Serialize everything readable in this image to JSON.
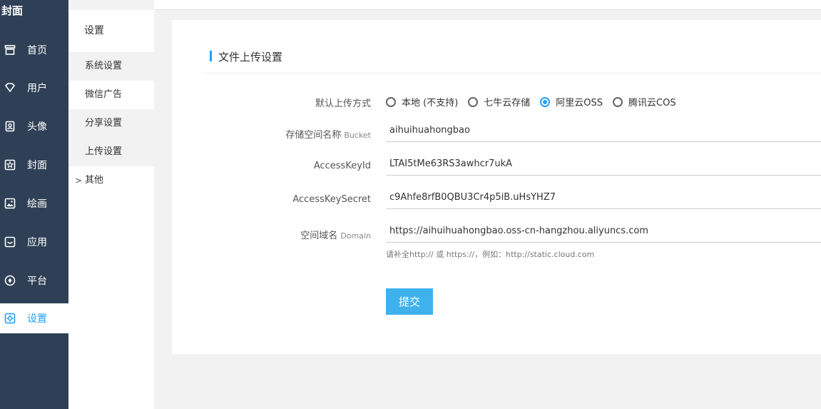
{
  "sidebar": {
    "brand": "封面",
    "items": [
      {
        "label": "首页",
        "icon": "store-icon"
      },
      {
        "label": "用户",
        "icon": "diamond-icon"
      },
      {
        "label": "头像",
        "icon": "user-card-icon"
      },
      {
        "label": "封面",
        "icon": "star-icon"
      },
      {
        "label": "绘画",
        "icon": "image-icon"
      },
      {
        "label": "应用",
        "icon": "app-icon"
      },
      {
        "label": "平台",
        "icon": "compass-icon"
      },
      {
        "label": "设置",
        "icon": "gear-icon"
      }
    ]
  },
  "submenu": {
    "title": "设置",
    "items": [
      "系统设置",
      "微信广告",
      "分享设置",
      "上传设置",
      "其他"
    ]
  },
  "form": {
    "title": "文件上传设置",
    "upload_label": "默认上传方式",
    "upload_options": [
      "本地 (不支持)",
      "七牛云存储",
      "阿里云OSS",
      "腾讯云COS"
    ],
    "bucket_label": "存储空间名称",
    "bucket_suffix": "Bucket",
    "bucket_value": "aihuihuahongbao",
    "keyid_label": "AccessKeyId",
    "keyid_value": "LTAI5tMe63RS3awhcr7ukA",
    "secret_label": "AccessKeySecret",
    "secret_value": "c9Ahfe8rfB0QBU3Cr4p5iB.uHsYHZ7",
    "domain_label": "空间域名",
    "domain_suffix": "Domain",
    "domain_value": "https://aihuihuahongbao.oss-cn-hangzhou.aliyuncs.com",
    "domain_hint": "请补全http:// 或 https://，例如：http://static.cloud.com",
    "submit_label": "提交"
  },
  "colors": {
    "sidebar": "#2f4056",
    "accent": "#1e9fff",
    "button": "#3fb2ee"
  }
}
